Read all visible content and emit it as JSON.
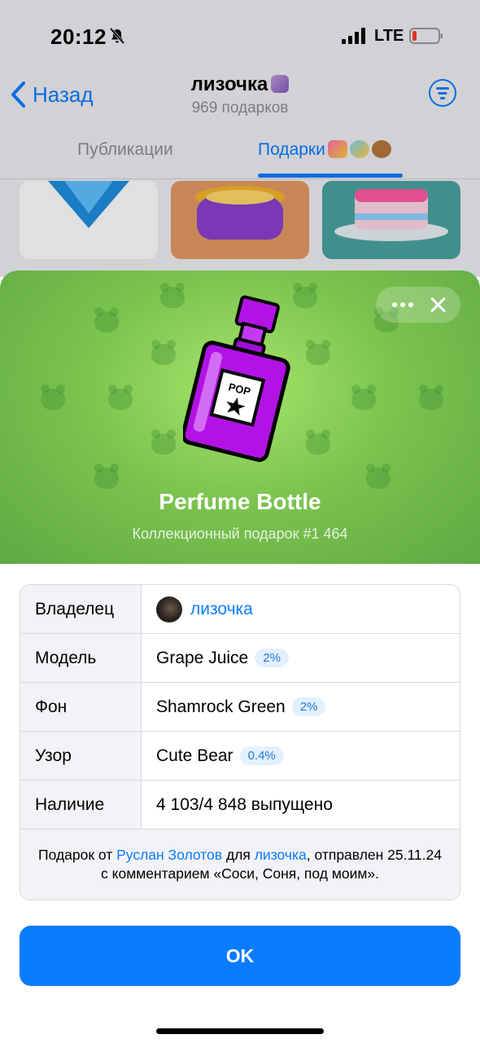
{
  "status_bar": {
    "time": "20:12",
    "network": "LTE"
  },
  "nav": {
    "back_label": "Назад",
    "title": "лизочка",
    "subtitle": "969 подарков"
  },
  "tabs": [
    {
      "label": "Публикации"
    },
    {
      "label": "Подарки"
    }
  ],
  "gift": {
    "title": "Perfume Bottle",
    "subtitle": "Коллекционный подарок #1 464",
    "bottle_label": "POP"
  },
  "details": {
    "owner_label": "Владелец",
    "owner_value": "лизочка",
    "model_label": "Модель",
    "model_value": "Grape Juice",
    "model_rarity": "2%",
    "background_label": "Фон",
    "background_value": "Shamrock Green",
    "background_rarity": "2%",
    "pattern_label": "Узор",
    "pattern_value": "Cute Bear",
    "pattern_rarity": "0.4%",
    "availability_label": "Наличие",
    "availability_value": "4 103/4 848 выпущено"
  },
  "caption": {
    "prefix": "Подарок от ",
    "sender": "Руслан Золотов",
    "middle": " для ",
    "recipient": "лизочка",
    "suffix": ", отправлен 25.11.24 с комментарием «Соси, Соня, под моим»."
  },
  "ok_label": "OK",
  "colors": {
    "accent": "#0a7cff",
    "hero_green": "#7cc44f",
    "bottle_purple": "#b312e6"
  },
  "icons": [
    "bell-muted-icon",
    "signal-icon",
    "battery-icon",
    "back-chevron-icon",
    "filter-icon",
    "more-icon",
    "close-icon",
    "bear-pattern-icon",
    "perfume-bottle-icon"
  ]
}
